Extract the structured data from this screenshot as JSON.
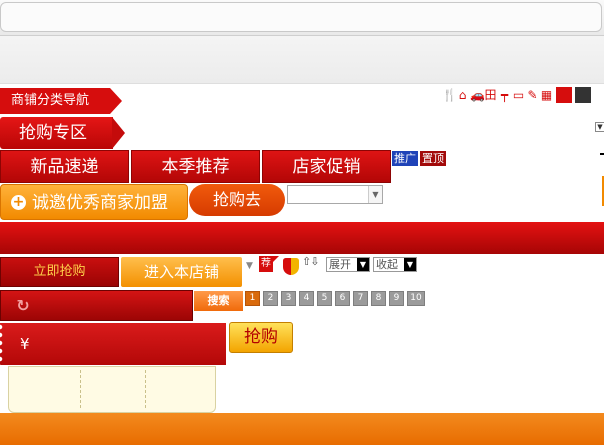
{
  "shop_nav": {
    "label": "商铺分类导航"
  },
  "toolbar_icons": [
    "utensils-icon",
    "home-icon",
    "car-icon",
    "table-icon",
    "faucet-icon",
    "monitor-icon",
    "broom-icon",
    "grid-icon"
  ],
  "rush_zone": {
    "label": "抢购专区"
  },
  "tabs": [
    {
      "label": "新品速递"
    },
    {
      "label": "本季推荐"
    },
    {
      "label": "店家促销"
    }
  ],
  "badges": {
    "promo": "推广",
    "top": "置顶"
  },
  "join_button": {
    "label": "诚邀优秀商家加盟"
  },
  "go_rush_button": {
    "label": "抢购去"
  },
  "buy_now_button": {
    "label": "立即抢购"
  },
  "enter_store_button": {
    "label": "进入本店铺"
  },
  "recommend_badge": {
    "label": "荐"
  },
  "expand": {
    "label": "展开"
  },
  "collapse": {
    "label": "收起"
  },
  "search_button": {
    "label": "搜索"
  },
  "pagination": {
    "pages": [
      "1",
      "2",
      "3",
      "4",
      "5",
      "6",
      "7",
      "8",
      "9",
      "10"
    ],
    "current": "1"
  },
  "price": {
    "currency": "¥"
  },
  "buy_button": {
    "label": "抢购"
  },
  "colors": {
    "brand_red": "#d60d0d",
    "accent_orange": "#f28a00",
    "bottom_orange": "#ee7a0e"
  }
}
